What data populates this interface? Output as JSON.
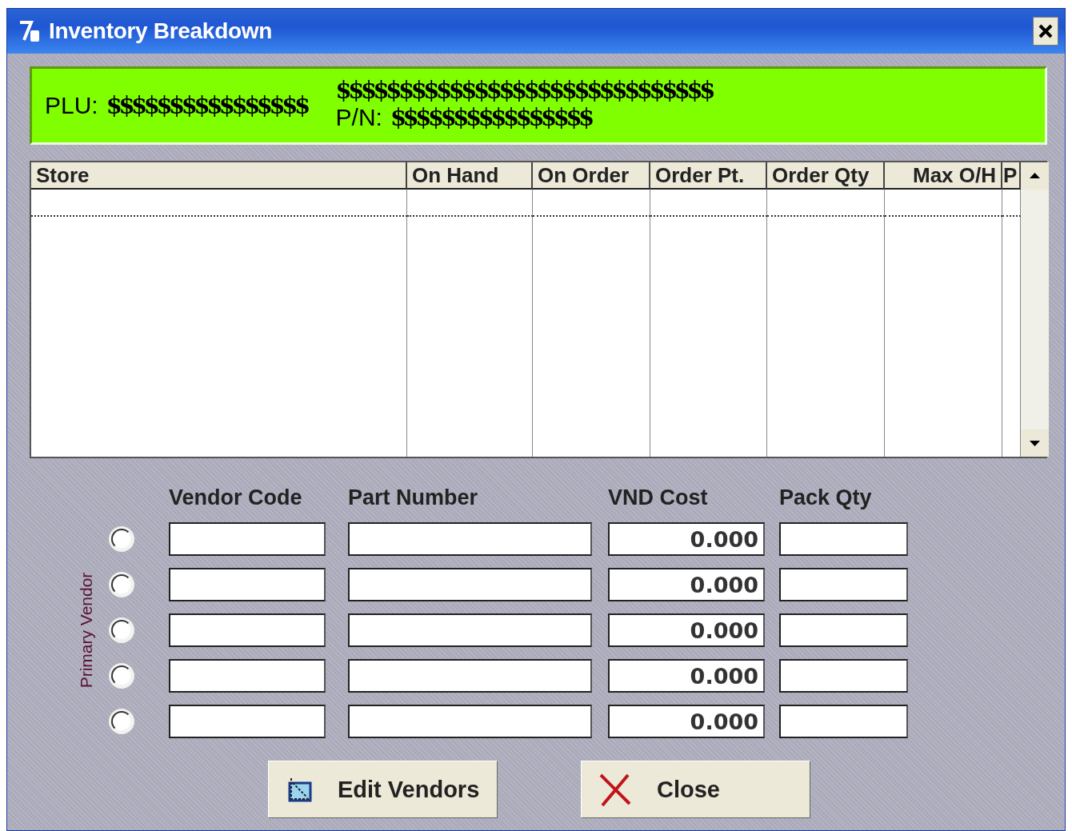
{
  "window": {
    "title": "Inventory Breakdown"
  },
  "header": {
    "plu_label": "PLU:",
    "plu_value": "$$$$$$$$$$$$$$$$",
    "description": "$$$$$$$$$$$$$$$$$$$$$$$$$$$$$$",
    "pn_label": "P/N:",
    "pn_value": "$$$$$$$$$$$$$$$$"
  },
  "table": {
    "columns": [
      "Store",
      "On Hand",
      "On Order",
      "Order Pt.",
      "Order Qty",
      "Max O/H",
      "P"
    ]
  },
  "vendors": {
    "side_label": "Primary Vendor",
    "columns": [
      "Vendor Code",
      "Part Number",
      "VND Cost",
      "Pack Qty"
    ],
    "rows": [
      {
        "selected": false,
        "vendor_code": "",
        "part_number": "",
        "cost": "0.000",
        "pack_qty": ""
      },
      {
        "selected": false,
        "vendor_code": "",
        "part_number": "",
        "cost": "0.000",
        "pack_qty": ""
      },
      {
        "selected": false,
        "vendor_code": "",
        "part_number": "",
        "cost": "0.000",
        "pack_qty": ""
      },
      {
        "selected": false,
        "vendor_code": "",
        "part_number": "",
        "cost": "0.000",
        "pack_qty": ""
      },
      {
        "selected": false,
        "vendor_code": "",
        "part_number": "",
        "cost": "0.000",
        "pack_qty": ""
      }
    ]
  },
  "buttons": [
    {
      "kind": "edit",
      "label": "Edit Vendors"
    },
    {
      "kind": "close",
      "label": "Close"
    }
  ]
}
